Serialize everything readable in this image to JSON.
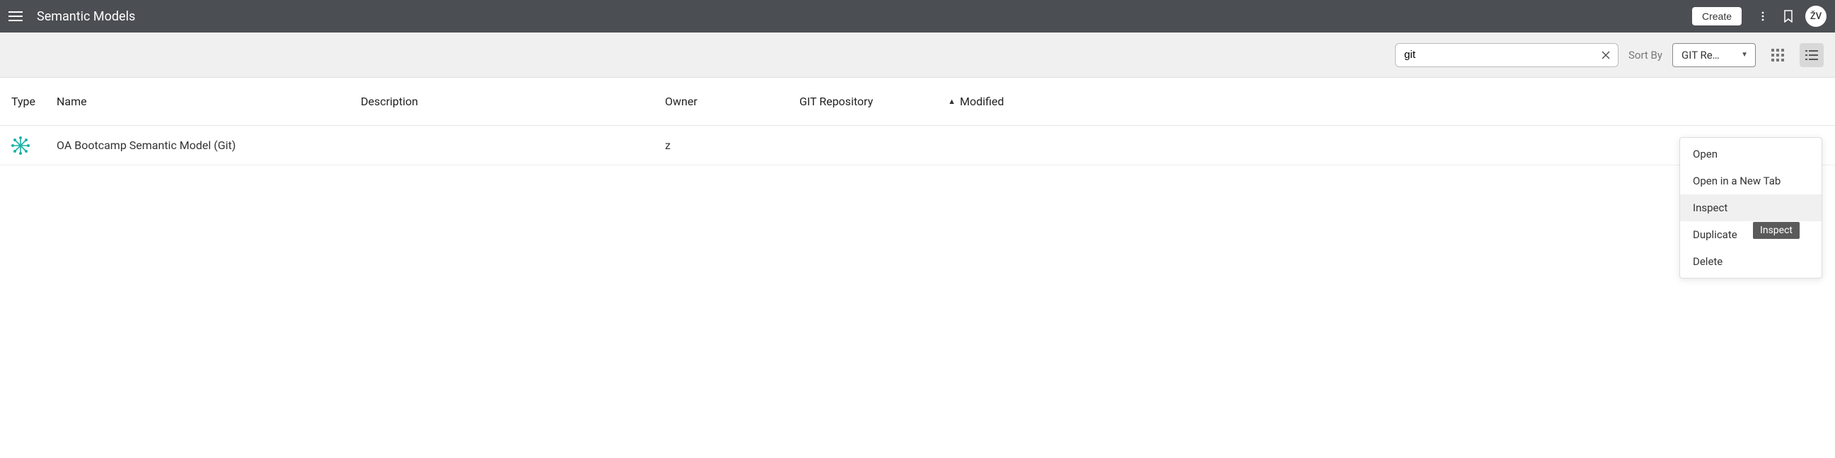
{
  "header": {
    "title": "Semantic Models",
    "create_label": "Create",
    "avatar_initials": "ŽV"
  },
  "toolbar": {
    "search_value": "git",
    "sortby_label": "Sort By",
    "sort_selected": "GIT Re…"
  },
  "columns": {
    "type": "Type",
    "name": "Name",
    "description": "Description",
    "owner": "Owner",
    "git_repo": "GIT Repository",
    "modified": "Modified"
  },
  "rows": [
    {
      "name": "OA Bootcamp Semantic Model (Git)",
      "description": "",
      "owner": "z",
      "git_repo": "",
      "modified": ""
    }
  ],
  "context_menu": {
    "items": [
      {
        "label": "Open",
        "highlight": false
      },
      {
        "label": "Open in a New Tab",
        "highlight": false
      },
      {
        "label": "Inspect",
        "highlight": true
      },
      {
        "label": "Duplicate",
        "highlight": false
      },
      {
        "label": "Delete",
        "highlight": false
      }
    ]
  },
  "tooltip": "Inspect"
}
